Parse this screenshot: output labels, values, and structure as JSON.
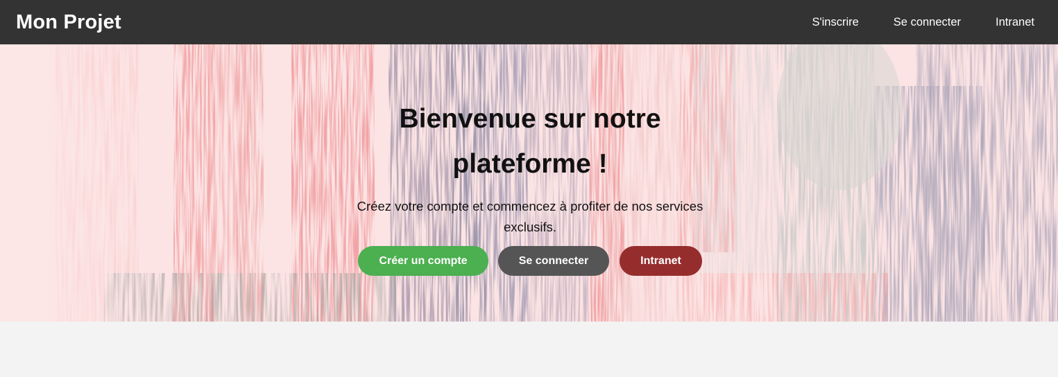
{
  "header": {
    "brand": "Mon Projet",
    "nav": [
      {
        "label": "S'inscrire"
      },
      {
        "label": "Se connecter"
      },
      {
        "label": "Intranet"
      }
    ]
  },
  "hero": {
    "title": "Bienvenue sur notre plateforme !",
    "subtitle": "Créez votre compte et commencez à profiter de nos services exclusifs.",
    "buttons": [
      {
        "label": "Créer un compte",
        "color": "#4caf50"
      },
      {
        "label": "Se connecter",
        "color": "#555555"
      },
      {
        "label": "Intranet",
        "color": "#962d2d"
      }
    ]
  },
  "colors": {
    "navbar_bg": "#333333",
    "page_bg": "#f3f3f3"
  }
}
